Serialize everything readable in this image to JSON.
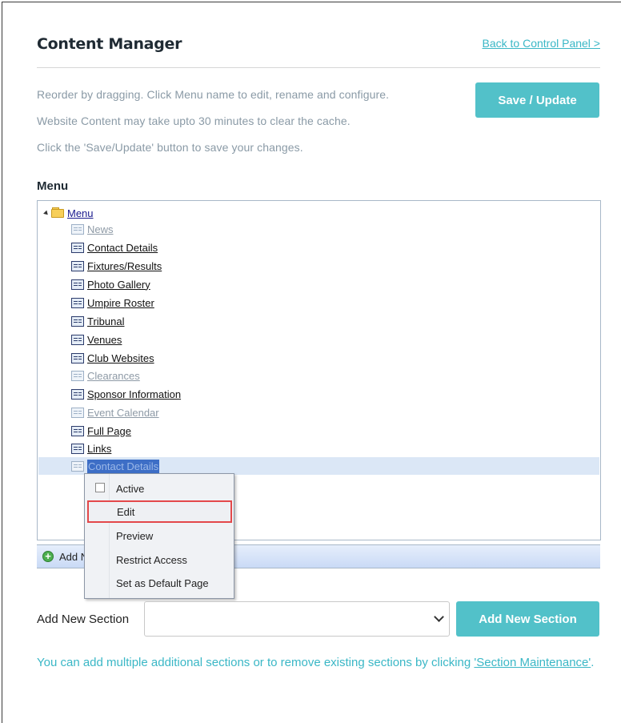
{
  "header": {
    "title": "Content Manager",
    "back_link": "Back to Control Panel >"
  },
  "info": {
    "line1": "Reorder by dragging. Click Menu name to edit, rename and configure.",
    "line2": "Website Content may take upto 30 minutes to clear the cache.",
    "line3": "Click the 'Save/Update' button to save your changes."
  },
  "save_button": "Save / Update",
  "menu_label": "Menu",
  "tree": {
    "root": "Menu",
    "items": [
      {
        "label": "News",
        "active": false
      },
      {
        "label": "Contact Details",
        "active": true
      },
      {
        "label": "Fixtures/Results",
        "active": true
      },
      {
        "label": "Photo Gallery",
        "active": true
      },
      {
        "label": "Umpire Roster",
        "active": true
      },
      {
        "label": "Tribunal",
        "active": true
      },
      {
        "label": "Venues",
        "active": true
      },
      {
        "label": "Club Websites",
        "active": true
      },
      {
        "label": "Clearances",
        "active": false
      },
      {
        "label": "Sponsor Information",
        "active": true
      },
      {
        "label": "Event Calendar",
        "active": false
      },
      {
        "label": "Full Page",
        "active": true
      },
      {
        "label": "Links",
        "active": true
      },
      {
        "label": "Contact Details",
        "active": false,
        "selected": true
      }
    ]
  },
  "add_bar": {
    "text": "Add N"
  },
  "context_menu": {
    "items": [
      "Active",
      "Edit",
      "Preview",
      "Restrict Access",
      "Set as Default Page"
    ],
    "highlighted": "Edit"
  },
  "add_section": {
    "label": "Add New Section",
    "select_value": "",
    "button": "Add New Section"
  },
  "footer": {
    "text": "You can add multiple additional sections or to remove existing sections by clicking ",
    "link": "'Section Maintenance'",
    "suffix": "."
  },
  "colors": {
    "accent": "#52c1c9",
    "link": "#3ab7c6",
    "highlight_border": "#e3484a"
  }
}
